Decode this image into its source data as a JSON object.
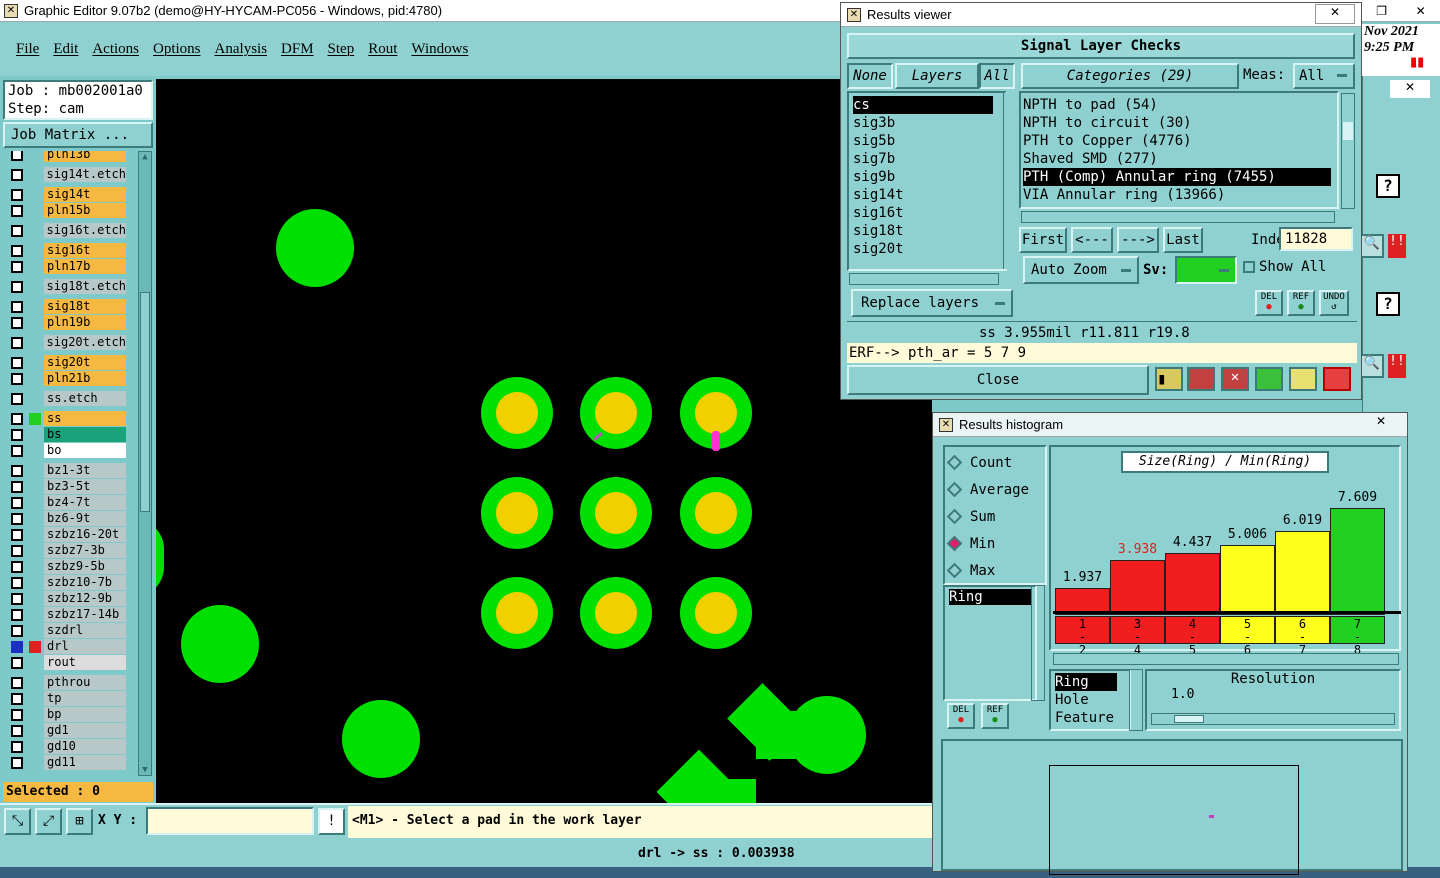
{
  "app": {
    "title": "Graphic Editor 9.07b2 (demo@HY-HYCAM-PC056 - Windows, pid:4780)",
    "menu": [
      "File",
      "Edit",
      "Actions",
      "Options",
      "Analysis",
      "DFM",
      "Step",
      "Rout",
      "Windows"
    ],
    "clock_date": "Nov 2021",
    "clock_time": "9:25 PM",
    "job": "Job : mb002001a0",
    "step": "Step: cam",
    "job_matrix": "Job Matrix ...",
    "selected": "Selected : 0",
    "xy_label": "X Y :",
    "xy_value": "",
    "prompt": "<M1> - Select a pad in the work layer",
    "status": "drl -> ss : 0.003938"
  },
  "layers": [
    {
      "name": "pln13b",
      "color": "#f5b942",
      "group": "a"
    },
    {
      "name": "sig14t.etch",
      "color": "#b8c8c8",
      "group": "b"
    },
    {
      "name": "sig14t",
      "color": "#f5b942",
      "group": "c"
    },
    {
      "name": "pln15b",
      "color": "#f5b942",
      "group": "c"
    },
    {
      "name": "sig16t.etch",
      "color": "#b8c8c8",
      "group": "d"
    },
    {
      "name": "sig16t",
      "color": "#f5b942",
      "group": "e"
    },
    {
      "name": "pln17b",
      "color": "#f5b942",
      "group": "e"
    },
    {
      "name": "sig18t.etch",
      "color": "#b8c8c8",
      "group": "f"
    },
    {
      "name": "sig18t",
      "color": "#f5b942",
      "group": "g"
    },
    {
      "name": "pln19b",
      "color": "#f5b942",
      "group": "g"
    },
    {
      "name": "sig20t.etch",
      "color": "#b8c8c8",
      "group": "h"
    },
    {
      "name": "sig20t",
      "color": "#f5b942",
      "group": "i"
    },
    {
      "name": "pln21b",
      "color": "#f5b942",
      "group": "i"
    },
    {
      "name": "ss.etch",
      "color": "#b8c8c8",
      "group": "j"
    },
    {
      "name": "ss",
      "color": "#f5b942",
      "group": "k"
    },
    {
      "name": "bs",
      "color": "#1aa37a",
      "group": "k"
    },
    {
      "name": "bo",
      "color": "#ffffff",
      "group": "k"
    },
    {
      "name": "bz1-3t",
      "color": "#b8c8c8",
      "group": "l"
    },
    {
      "name": "bz3-5t",
      "color": "#b8c8c8",
      "group": "l"
    },
    {
      "name": "bz4-7t",
      "color": "#b8c8c8",
      "group": "l"
    },
    {
      "name": "bz6-9t",
      "color": "#b8c8c8",
      "group": "l"
    },
    {
      "name": "szbz16-20t",
      "color": "#b8c8c8",
      "group": "l"
    },
    {
      "name": "szbz7-3b",
      "color": "#b8c8c8",
      "group": "l"
    },
    {
      "name": "szbz9-5b",
      "color": "#b8c8c8",
      "group": "l"
    },
    {
      "name": "szbz10-7b",
      "color": "#b8c8c8",
      "group": "l"
    },
    {
      "name": "szbz12-9b",
      "color": "#b8c8c8",
      "group": "l"
    },
    {
      "name": "szbz17-14b",
      "color": "#b8c8c8",
      "group": "l"
    },
    {
      "name": "szdrl",
      "color": "#b8c8c8",
      "group": "l"
    },
    {
      "name": "drl",
      "color": "#b8c8c8",
      "group": "l"
    },
    {
      "name": "rout",
      "color": "#dcdcdc",
      "group": "l"
    },
    {
      "name": "pthrou",
      "color": "#b8c8c8",
      "group": "m"
    },
    {
      "name": "tp",
      "color": "#b8c8c8",
      "group": "m"
    },
    {
      "name": "bp",
      "color": "#b8c8c8",
      "group": "m"
    },
    {
      "name": "gd1",
      "color": "#b8c8c8",
      "group": "m"
    },
    {
      "name": "gd10",
      "color": "#b8c8c8",
      "group": "m"
    },
    {
      "name": "gd11",
      "color": "#b8c8c8",
      "group": "m"
    }
  ],
  "results_viewer": {
    "title": "Results viewer",
    "header": "Signal Layer Checks",
    "btn_none": "None",
    "btn_layers": "Layers",
    "btn_all": "All",
    "categories": "Categories (29)",
    "meas_label": "Meas:",
    "meas_value": "All",
    "layer_list": [
      "cs",
      "sig3b",
      "sig5b",
      "sig7b",
      "sig9b",
      "sig14t",
      "sig16t",
      "sig18t",
      "sig20t"
    ],
    "category_list": [
      "NPTH to pad (54)",
      "NPTH to circuit (30)",
      "PTH to Copper (4776)",
      "Shaved SMD (277)",
      "PTH (Comp) Annular ring (7455)",
      "VIA Annular ring (13966)"
    ],
    "selected_category_index": 4,
    "nav": [
      "First",
      "<---",
      "--->",
      "Last"
    ],
    "index_label": "Index:",
    "index_value": "11828",
    "auto_zoom": "Auto Zoom",
    "sv_label": "Sv:",
    "show_all": "Show All",
    "replace_layers": "Replace layers",
    "icon_del": "DEL",
    "icon_ref": "REF",
    "icon_undo": "UNDO",
    "measure_line": "ss 3.955mil  r11.811  r19.8",
    "erf_line": "ERF--> pth_ar = 5 7 9",
    "close": "Close"
  },
  "histogram": {
    "title": "Results histogram",
    "modes": [
      "Count",
      "Average",
      "Sum",
      "Min",
      "Max"
    ],
    "selected_mode": "Min",
    "field_list": [
      "Ring"
    ],
    "list_selected": "Ring",
    "attr_list": [
      "Ring",
      "Hole",
      "Feature"
    ],
    "resolution_label": "Resolution",
    "resolution_value": "1.0",
    "icon_del": "DEL",
    "icon_ref": "REF"
  },
  "chart_data": {
    "type": "bar",
    "title": "Size(Ring) / Min(Ring)",
    "categories": [
      "1-2",
      "3-4",
      "4-5",
      "5-6",
      "6-7",
      "7-8"
    ],
    "values": [
      1.937,
      3.938,
      4.437,
      5.006,
      6.019,
      7.609
    ],
    "value_labels": [
      "1.937",
      "3.938",
      "4.437",
      "5.006",
      "6.019",
      "7.609"
    ],
    "colors": [
      "#f01e1e",
      "#f01e1e",
      "#f01e1e",
      "#ffff1e",
      "#ffff1e",
      "#22d022"
    ],
    "highlight_label_index": 1,
    "ylim": [
      0,
      8
    ]
  }
}
